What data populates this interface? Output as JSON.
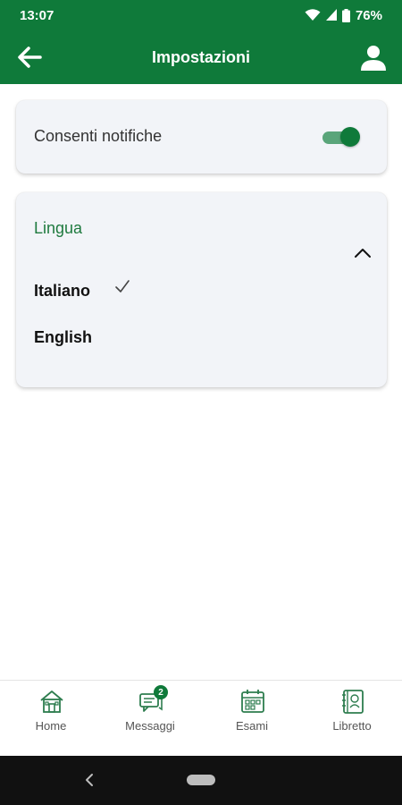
{
  "status": {
    "time": "13:07",
    "battery": "76%"
  },
  "appbar": {
    "title": "Impostazioni"
  },
  "notifications": {
    "label": "Consenti notifiche",
    "enabled": true
  },
  "language": {
    "header": "Lingua",
    "options": [
      "Italiano",
      "English"
    ],
    "selected": "Italiano"
  },
  "bottom_nav": {
    "items": [
      {
        "label": "Home",
        "icon": "home-icon"
      },
      {
        "label": "Messaggi",
        "icon": "messages-icon",
        "badge": "2"
      },
      {
        "label": "Esami",
        "icon": "calendar-icon"
      },
      {
        "label": "Libretto",
        "icon": "booklet-icon"
      }
    ]
  },
  "colors": {
    "primary": "#0f7a3a",
    "accent_text": "#1f7a3f",
    "card_bg": "#f2f4f8"
  }
}
